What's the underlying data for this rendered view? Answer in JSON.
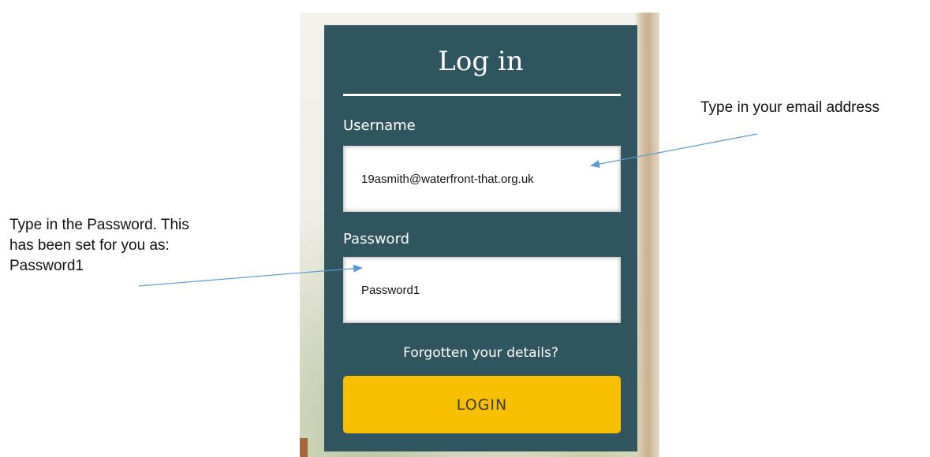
{
  "login": {
    "title": "Log in",
    "username_label": "Username",
    "username_value": "19asmith@waterfront-that.org.uk",
    "password_label": "Password",
    "password_value": "Password1",
    "forgot_link": "Forgotten your details?",
    "login_button": "LOGIN"
  },
  "annotations": {
    "email_note": "Type in your email address",
    "password_note_line1": "Type in the Password.  This",
    "password_note_line2": "has been set for you as:",
    "password_note_line3": "Password1"
  },
  "colors": {
    "panel": "#2f5560",
    "button": "#f8c000",
    "arrow": "#5b9bd5"
  }
}
